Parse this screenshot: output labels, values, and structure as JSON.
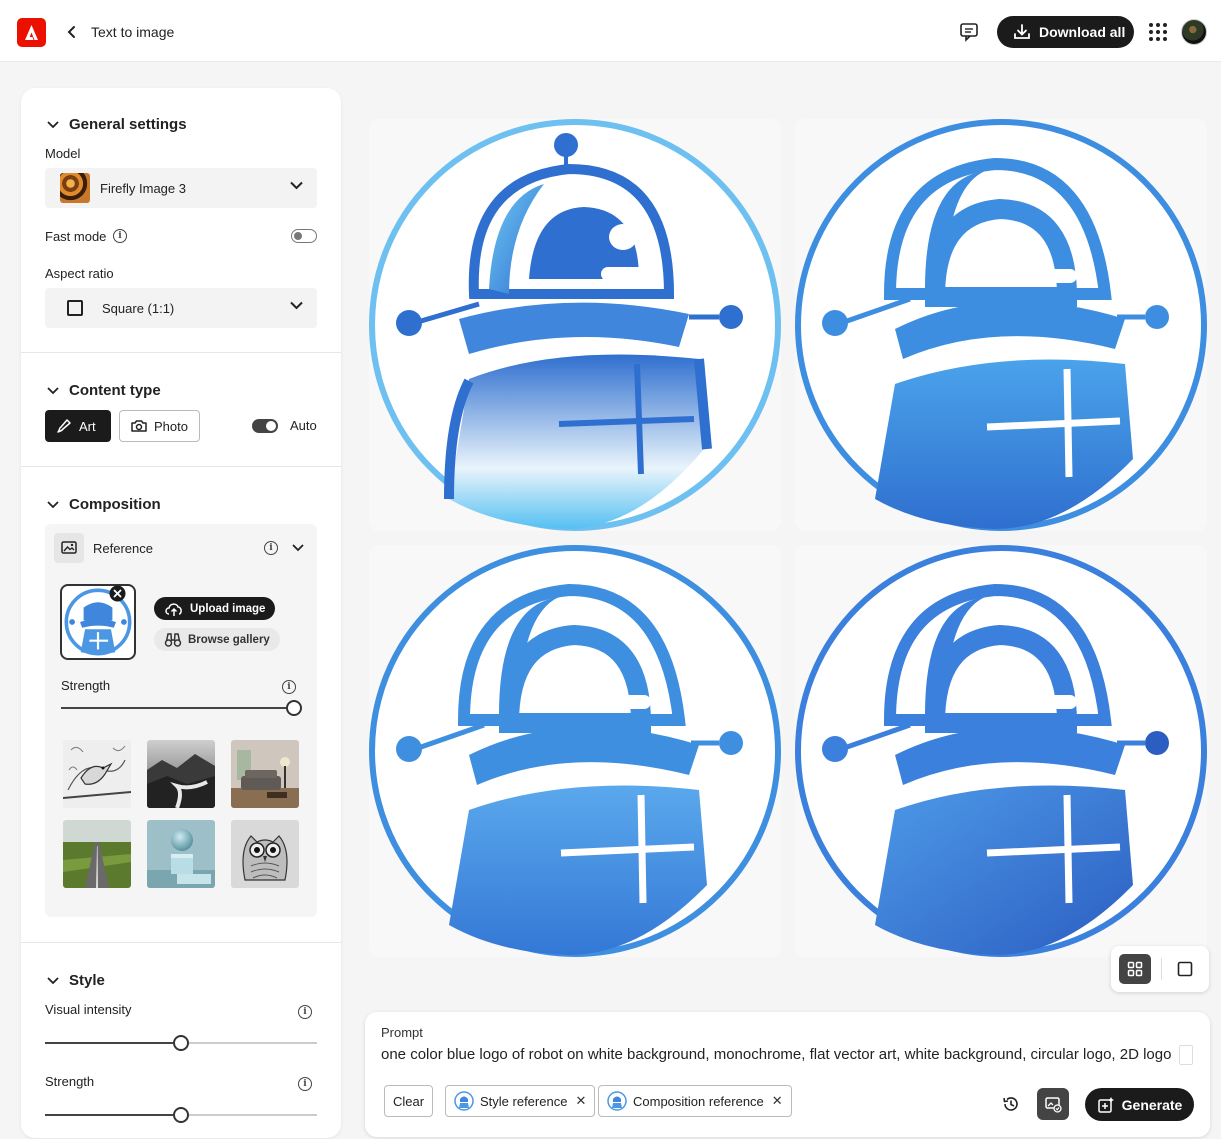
{
  "header": {
    "title": "Text to image",
    "download_label": "Download all"
  },
  "general": {
    "heading": "General settings",
    "model_label": "Model",
    "model_value": "Firefly Image 3",
    "fast_mode_label": "Fast mode",
    "fast_mode_on": false,
    "aspect_label": "Aspect ratio",
    "aspect_value": "Square (1:1)"
  },
  "content_type": {
    "heading": "Content type",
    "art_label": "Art",
    "photo_label": "Photo",
    "auto_label": "Auto",
    "selected": "Art",
    "auto_on": true
  },
  "composition": {
    "heading": "Composition",
    "reference_label": "Reference",
    "upload_label": "Upload image",
    "browse_label": "Browse gallery",
    "strength_label": "Strength",
    "strength_value": 1.0,
    "gallery": [
      "bird-sketch",
      "misty-river",
      "living-room",
      "country-road",
      "sphere-cube",
      "owl-sketch"
    ]
  },
  "style": {
    "heading": "Style",
    "visual_intensity_label": "Visual intensity",
    "visual_intensity_value": 0.5,
    "strength_label": "Strength",
    "strength_value": 0.5
  },
  "prompt": {
    "label": "Prompt",
    "text": "one color blue logo of robot on white background, monochrome, flat vector art, white background, circular logo, 2D logo,",
    "clear_label": "Clear",
    "style_ref_label": "Style reference",
    "comp_ref_label": "Composition reference",
    "generate_label": "Generate"
  },
  "colors": {
    "accent": "#eb1000",
    "robot_blue": "#3f86dc",
    "robot_dark": "#2f6fcf",
    "robot_light": "#6ec0f0"
  }
}
